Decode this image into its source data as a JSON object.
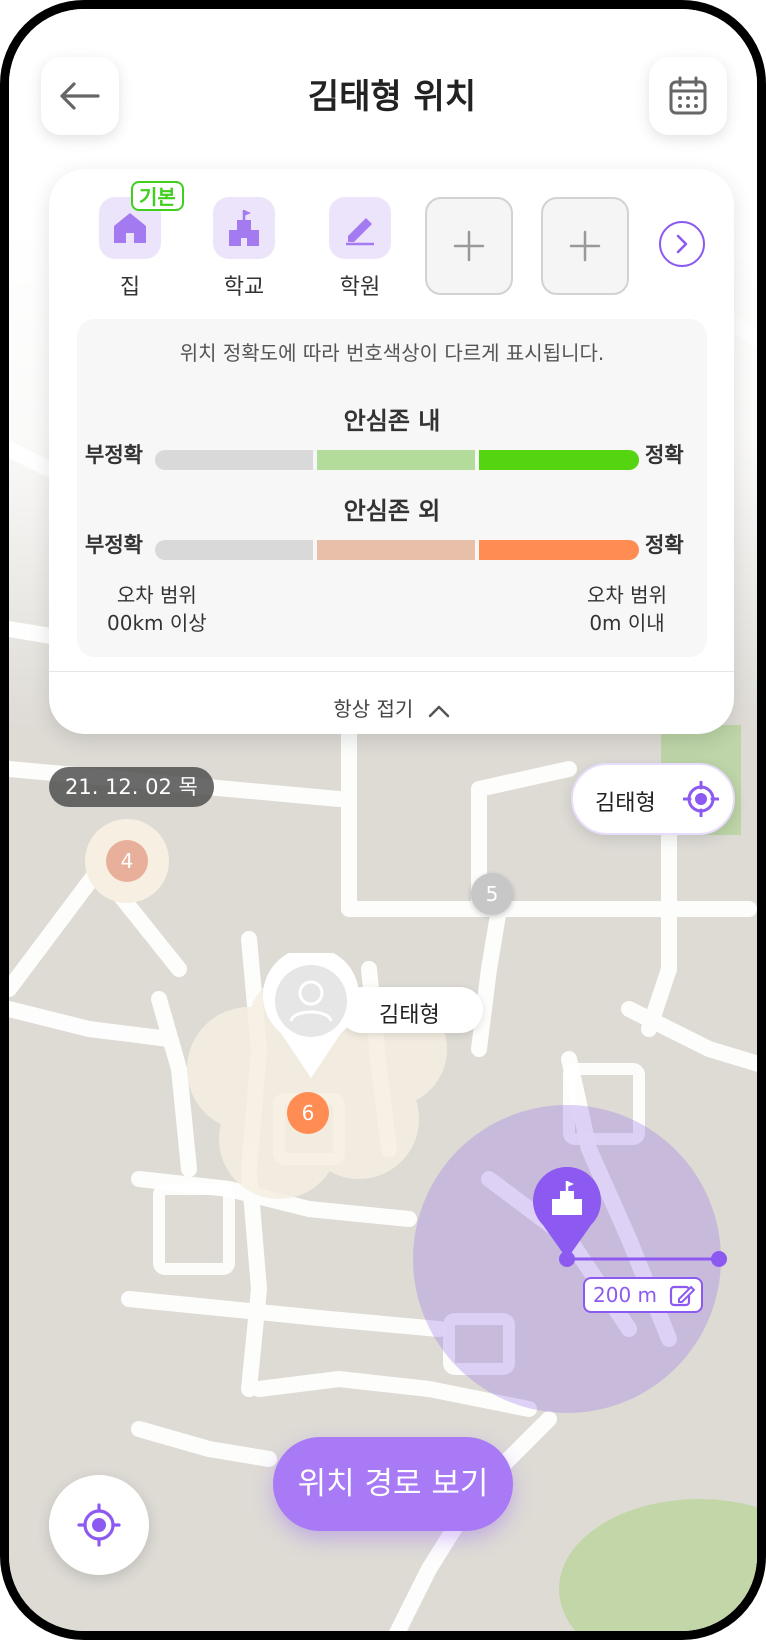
{
  "header": {
    "title": "김태형 위치"
  },
  "places": [
    {
      "label": "집",
      "icon": "home-icon"
    },
    {
      "label": "학교",
      "icon": "school-icon"
    },
    {
      "label": "학원",
      "icon": "pencil-icon"
    }
  ],
  "default_badge": "기본",
  "add_icon": "plus-icon",
  "legend": {
    "description": "위치 정확도에 따라 번호색상이 다르게 표시됩니다.",
    "inside_title": "안심존 내",
    "outside_title": "안심존 외",
    "inaccurate": "부정확",
    "accurate": "정확",
    "error_range": "오차 범위",
    "error_left": "00km 이상",
    "error_right": "0m 이내",
    "inside_colors": [
      "#d9d9d9",
      "#b3dc9b",
      "#55d411"
    ],
    "outside_colors": [
      "#d9d9d9",
      "#e8c0aa",
      "#ff8c52"
    ]
  },
  "collapse_label": "항상 접기",
  "date_label": "21. 12. 02 목",
  "locate_child": {
    "label": "김태형"
  },
  "markers": [
    {
      "number": "4",
      "color": "#e8b09a"
    },
    {
      "number": "5",
      "color": "#c7c7c7"
    },
    {
      "number": "6",
      "color": "#ff8c52"
    }
  ],
  "user_marker": {
    "name": "김태형"
  },
  "zone_radius": "200 m",
  "cta_label": "위치 경로 보기",
  "colors": {
    "accent": "#8c5af0",
    "accent_light": "#ece4fb",
    "default_green": "#3fcf1c"
  }
}
